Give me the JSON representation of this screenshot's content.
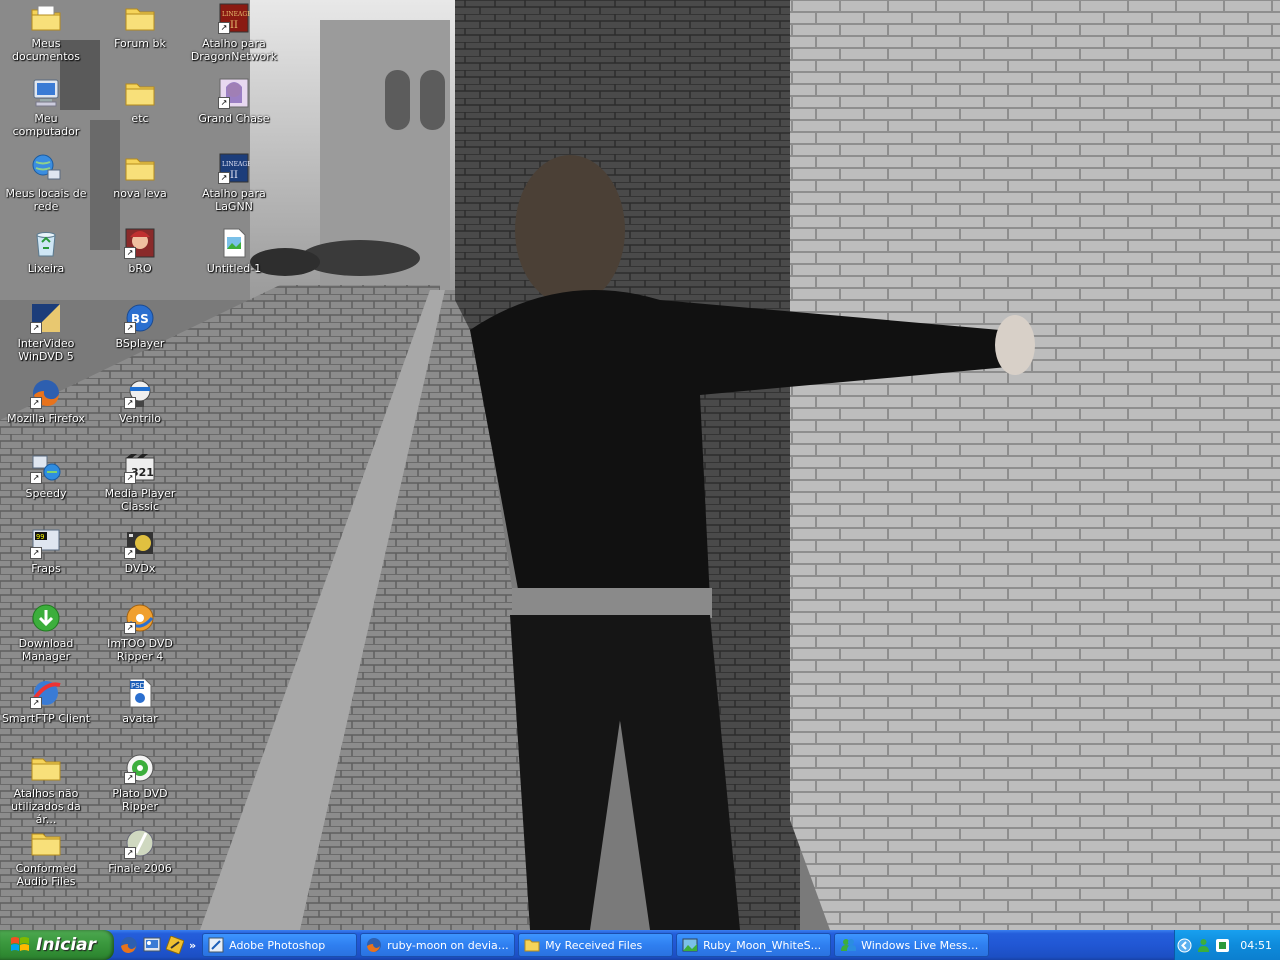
{
  "desktop": {
    "icons": [
      {
        "label": "Meus documentos",
        "icon": "my-documents-icon"
      },
      {
        "label": "Meu computador",
        "icon": "my-computer-icon"
      },
      {
        "label": "Meus locais de rede",
        "icon": "network-places-icon"
      },
      {
        "label": "Lixeira",
        "icon": "recycle-bin-icon"
      },
      {
        "label": "InterVideo WinDVD 5",
        "icon": "windvd-icon"
      },
      {
        "label": "Mozilla Firefox",
        "icon": "firefox-icon"
      },
      {
        "label": "Speedy",
        "icon": "speedy-icon"
      },
      {
        "label": "Fraps",
        "icon": "fraps-icon"
      },
      {
        "label": "Download Manager",
        "icon": "download-manager-icon"
      },
      {
        "label": "SmartFTP Client",
        "icon": "smartftp-icon"
      },
      {
        "label": "Atalhos não utilizados da ár...",
        "icon": "folder-icon"
      },
      {
        "label": "Conformed Audio Files",
        "icon": "folder-icon"
      },
      {
        "label": "Forum bk",
        "icon": "folder-icon"
      },
      {
        "label": "etc",
        "icon": "folder-icon"
      },
      {
        "label": "nova leva",
        "icon": "folder-icon"
      },
      {
        "label": "bRO",
        "icon": "bro-icon"
      },
      {
        "label": "BSplayer",
        "icon": "bsplayer-icon"
      },
      {
        "label": "Ventrilo",
        "icon": "ventrilo-icon"
      },
      {
        "label": "Media Player Classic",
        "icon": "media-player-classic-icon"
      },
      {
        "label": "DVDx",
        "icon": "dvdx-icon"
      },
      {
        "label": "ImTOO DVD Ripper 4",
        "icon": "imtoo-icon"
      },
      {
        "label": "avatar",
        "icon": "psd-file-icon"
      },
      {
        "label": "Plato DVD Ripper",
        "icon": "plato-icon"
      },
      {
        "label": "Finale 2006",
        "icon": "finale-icon"
      },
      {
        "label": "Atalho para DragonNetwork",
        "icon": "lineage-icon"
      },
      {
        "label": "Grand Chase",
        "icon": "grand-chase-icon"
      },
      {
        "label": "Atalho para LaGNN",
        "icon": "lineage-icon"
      },
      {
        "label": "Untitled-1",
        "icon": "image-file-icon"
      }
    ]
  },
  "taskbar": {
    "start_label": "Iniciar",
    "tasks": [
      {
        "label": "Adobe Photoshop",
        "icon": "photoshop-icon"
      },
      {
        "label": "ruby-moon on devian...",
        "icon": "firefox-icon"
      },
      {
        "label": "My Received Files",
        "icon": "folder-icon"
      },
      {
        "label": "Ruby_Moon_WhiteS...",
        "icon": "image-viewer-icon"
      },
      {
        "label": "Windows Live Messen...",
        "icon": "messenger-icon"
      }
    ],
    "clock": "04:51",
    "quicklaunch_more": "»"
  },
  "colors": {
    "taskbar_blue": "#245edb",
    "start_green": "#3c9a3f",
    "tray_blue": "#0e8bdb"
  }
}
